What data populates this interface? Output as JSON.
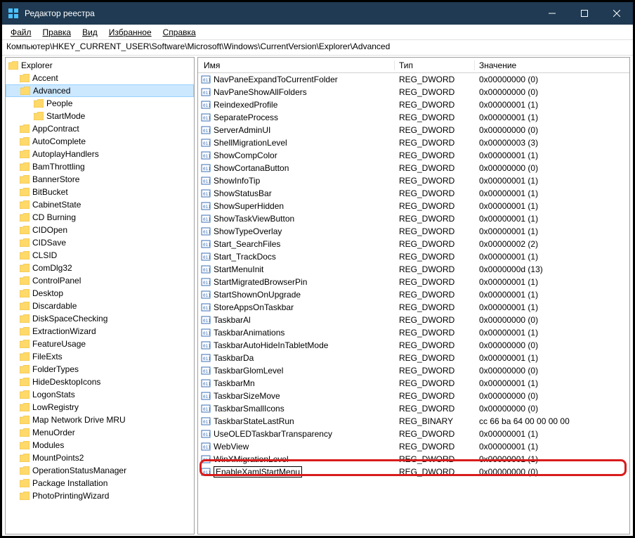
{
  "window": {
    "title": "Редактор реестра"
  },
  "menu": {
    "file": "Файл",
    "edit": "Правка",
    "view": "Вид",
    "favorites": "Избранное",
    "help": "Справка"
  },
  "address": "Компьютер\\HKEY_CURRENT_USER\\Software\\Microsoft\\Windows\\CurrentVersion\\Explorer\\Advanced",
  "columns": {
    "name": "Имя",
    "type": "Тип",
    "value": "Значение"
  },
  "tree": {
    "root": "Explorer",
    "items": [
      {
        "label": "Accent",
        "indent": 1
      },
      {
        "label": "Advanced",
        "indent": 1,
        "selected": true
      },
      {
        "label": "People",
        "indent": 2
      },
      {
        "label": "StartMode",
        "indent": 2
      },
      {
        "label": "AppContract",
        "indent": 1
      },
      {
        "label": "AutoComplete",
        "indent": 1
      },
      {
        "label": "AutoplayHandlers",
        "indent": 1
      },
      {
        "label": "BamThrottling",
        "indent": 1
      },
      {
        "label": "BannerStore",
        "indent": 1
      },
      {
        "label": "BitBucket",
        "indent": 1
      },
      {
        "label": "CabinetState",
        "indent": 1
      },
      {
        "label": "CD Burning",
        "indent": 1
      },
      {
        "label": "CIDOpen",
        "indent": 1
      },
      {
        "label": "CIDSave",
        "indent": 1
      },
      {
        "label": "CLSID",
        "indent": 1
      },
      {
        "label": "ComDlg32",
        "indent": 1
      },
      {
        "label": "ControlPanel",
        "indent": 1
      },
      {
        "label": "Desktop",
        "indent": 1
      },
      {
        "label": "Discardable",
        "indent": 1
      },
      {
        "label": "DiskSpaceChecking",
        "indent": 1
      },
      {
        "label": "ExtractionWizard",
        "indent": 1
      },
      {
        "label": "FeatureUsage",
        "indent": 1
      },
      {
        "label": "FileExts",
        "indent": 1
      },
      {
        "label": "FolderTypes",
        "indent": 1
      },
      {
        "label": "HideDesktopIcons",
        "indent": 1
      },
      {
        "label": "LogonStats",
        "indent": 1
      },
      {
        "label": "LowRegistry",
        "indent": 1
      },
      {
        "label": "Map Network Drive MRU",
        "indent": 1
      },
      {
        "label": "MenuOrder",
        "indent": 1
      },
      {
        "label": "Modules",
        "indent": 1
      },
      {
        "label": "MountPoints2",
        "indent": 1
      },
      {
        "label": "OperationStatusManager",
        "indent": 1
      },
      {
        "label": "Package Installation",
        "indent": 1
      },
      {
        "label": "PhotoPrintingWizard",
        "indent": 1
      }
    ]
  },
  "values": [
    {
      "name": "NavPaneExpandToCurrentFolder",
      "type": "REG_DWORD",
      "value": "0x00000000 (0)"
    },
    {
      "name": "NavPaneShowAllFolders",
      "type": "REG_DWORD",
      "value": "0x00000000 (0)"
    },
    {
      "name": "ReindexedProfile",
      "type": "REG_DWORD",
      "value": "0x00000001 (1)"
    },
    {
      "name": "SeparateProcess",
      "type": "REG_DWORD",
      "value": "0x00000001 (1)"
    },
    {
      "name": "ServerAdminUI",
      "type": "REG_DWORD",
      "value": "0x00000000 (0)"
    },
    {
      "name": "ShellMigrationLevel",
      "type": "REG_DWORD",
      "value": "0x00000003 (3)"
    },
    {
      "name": "ShowCompColor",
      "type": "REG_DWORD",
      "value": "0x00000001 (1)"
    },
    {
      "name": "ShowCortanaButton",
      "type": "REG_DWORD",
      "value": "0x00000000 (0)"
    },
    {
      "name": "ShowInfoTip",
      "type": "REG_DWORD",
      "value": "0x00000001 (1)"
    },
    {
      "name": "ShowStatusBar",
      "type": "REG_DWORD",
      "value": "0x00000001 (1)"
    },
    {
      "name": "ShowSuperHidden",
      "type": "REG_DWORD",
      "value": "0x00000001 (1)"
    },
    {
      "name": "ShowTaskViewButton",
      "type": "REG_DWORD",
      "value": "0x00000001 (1)"
    },
    {
      "name": "ShowTypeOverlay",
      "type": "REG_DWORD",
      "value": "0x00000001 (1)"
    },
    {
      "name": "Start_SearchFiles",
      "type": "REG_DWORD",
      "value": "0x00000002 (2)"
    },
    {
      "name": "Start_TrackDocs",
      "type": "REG_DWORD",
      "value": "0x00000001 (1)"
    },
    {
      "name": "StartMenuInit",
      "type": "REG_DWORD",
      "value": "0x0000000d (13)"
    },
    {
      "name": "StartMigratedBrowserPin",
      "type": "REG_DWORD",
      "value": "0x00000001 (1)"
    },
    {
      "name": "StartShownOnUpgrade",
      "type": "REG_DWORD",
      "value": "0x00000001 (1)"
    },
    {
      "name": "StoreAppsOnTaskbar",
      "type": "REG_DWORD",
      "value": "0x00000001 (1)"
    },
    {
      "name": "TaskbarAl",
      "type": "REG_DWORD",
      "value": "0x00000000 (0)"
    },
    {
      "name": "TaskbarAnimations",
      "type": "REG_DWORD",
      "value": "0x00000001 (1)"
    },
    {
      "name": "TaskbarAutoHideInTabletMode",
      "type": "REG_DWORD",
      "value": "0x00000000 (0)"
    },
    {
      "name": "TaskbarDa",
      "type": "REG_DWORD",
      "value": "0x00000001 (1)"
    },
    {
      "name": "TaskbarGlomLevel",
      "type": "REG_DWORD",
      "value": "0x00000000 (0)"
    },
    {
      "name": "TaskbarMn",
      "type": "REG_DWORD",
      "value": "0x00000001 (1)"
    },
    {
      "name": "TaskbarSizeMove",
      "type": "REG_DWORD",
      "value": "0x00000000 (0)"
    },
    {
      "name": "TaskbarSmallIcons",
      "type": "REG_DWORD",
      "value": "0x00000000 (0)"
    },
    {
      "name": "TaskbarStateLastRun",
      "type": "REG_BINARY",
      "value": "cc 66 ba 64 00 00 00 00"
    },
    {
      "name": "UseOLEDTaskbarTransparency",
      "type": "REG_DWORD",
      "value": "0x00000001 (1)"
    },
    {
      "name": "WebView",
      "type": "REG_DWORD",
      "value": "0x00000001 (1)"
    },
    {
      "name": "WinXMigrationLevel",
      "type": "REG_DWORD",
      "value": "0x00000001 (1)"
    },
    {
      "name": "EnableXamlStartMenu",
      "type": "REG_DWORD",
      "value": "0x00000000 (0)",
      "editing": true,
      "highlight": true
    }
  ]
}
